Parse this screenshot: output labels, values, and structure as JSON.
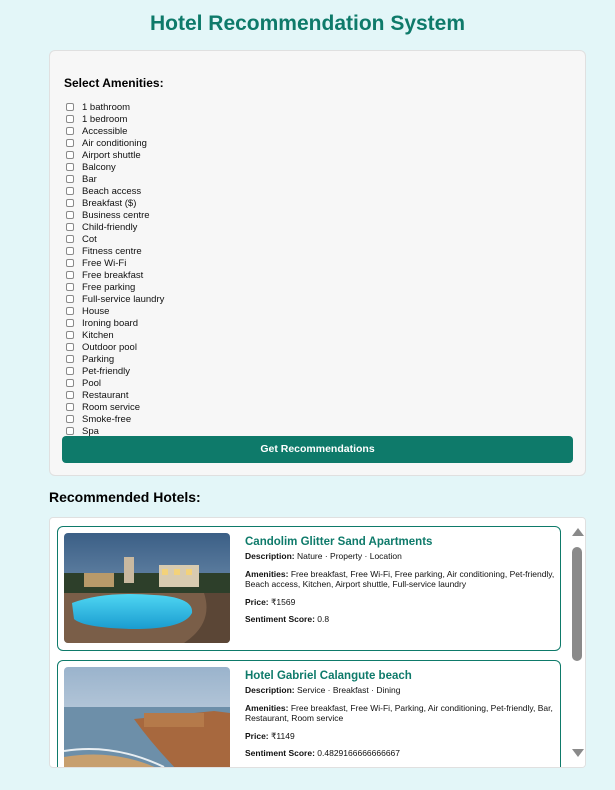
{
  "page_title": "Hotel Recommendation System",
  "amenities_label": "Select Amenities:",
  "amenities": [
    {
      "label": "1 bathroom",
      "checked": false
    },
    {
      "label": "1 bedroom",
      "checked": false
    },
    {
      "label": "Accessible",
      "checked": false
    },
    {
      "label": "Air conditioning",
      "checked": false
    },
    {
      "label": "Airport shuttle",
      "checked": false
    },
    {
      "label": "Balcony",
      "checked": false
    },
    {
      "label": "Bar",
      "checked": false
    },
    {
      "label": "Beach access",
      "checked": false
    },
    {
      "label": "Breakfast ($)",
      "checked": false
    },
    {
      "label": "Business centre",
      "checked": false
    },
    {
      "label": "Child-friendly",
      "checked": false
    },
    {
      "label": "Cot",
      "checked": false
    },
    {
      "label": "Fitness centre",
      "checked": false
    },
    {
      "label": "Free Wi-Fi",
      "checked": false
    },
    {
      "label": "Free breakfast",
      "checked": false
    },
    {
      "label": "Free parking",
      "checked": false
    },
    {
      "label": "Full-service laundry",
      "checked": false
    },
    {
      "label": "House",
      "checked": false
    },
    {
      "label": "Ironing board",
      "checked": false
    },
    {
      "label": "Kitchen",
      "checked": false
    },
    {
      "label": "Outdoor pool",
      "checked": false
    },
    {
      "label": "Parking",
      "checked": false
    },
    {
      "label": "Pet-friendly",
      "checked": false
    },
    {
      "label": "Pool",
      "checked": false
    },
    {
      "label": "Restaurant",
      "checked": false
    },
    {
      "label": "Room service",
      "checked": false
    },
    {
      "label": "Smoke-free",
      "checked": false
    },
    {
      "label": "Spa",
      "checked": false
    }
  ],
  "get_button_label": "Get Recommendations",
  "recommended_heading": "Recommended Hotels:",
  "field_labels": {
    "description": "Description:",
    "amenities": "Amenities:",
    "price": "Price:",
    "sentiment": "Sentiment Score:"
  },
  "hotels": [
    {
      "name": "Candolim Glitter Sand Apartments",
      "description": "Nature · Property · Location",
      "amenities": "Free breakfast, Free Wi-Fi, Free parking, Air conditioning, Pet-friendly, Beach access, Kitchen, Airport shuttle, Full-service laundry",
      "price": "₹1569",
      "sentiment": "0.8"
    },
    {
      "name": "Hotel Gabriel Calangute beach",
      "description": "Service · Breakfast · Dining",
      "amenities": "Free breakfast, Free Wi-Fi, Parking, Air conditioning, Pet-friendly, Bar, Restaurant, Room service",
      "price": "₹1149",
      "sentiment": "0.4829166666666667"
    }
  ],
  "colors": {
    "accent": "#0e7a6a",
    "background": "#e3f6f8"
  }
}
